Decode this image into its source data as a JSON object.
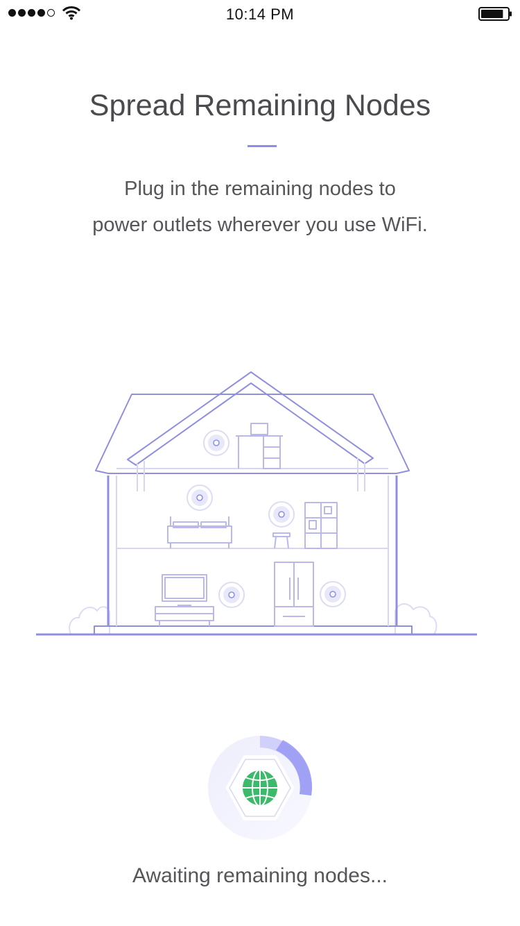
{
  "status_bar": {
    "time": "10:14 PM",
    "signal_bars_filled": 4,
    "signal_bars_total": 5,
    "battery_level": 0.85
  },
  "setup": {
    "title": "Spread Remaining Nodes",
    "subtitle_line1": "Plug in the remaining nodes to",
    "subtitle_line2": "power outlets wherever you use WiFi.",
    "status": "Awaiting remaining nodes..."
  },
  "colors": {
    "accent": "#8c8cf0",
    "house_line": "#8f8fe0",
    "globe": "#3cb96a",
    "text": "#4a4a4f"
  },
  "icons": [
    "signal-icon",
    "wifi-icon",
    "battery-icon",
    "globe-icon",
    "wifi-node-icon"
  ]
}
